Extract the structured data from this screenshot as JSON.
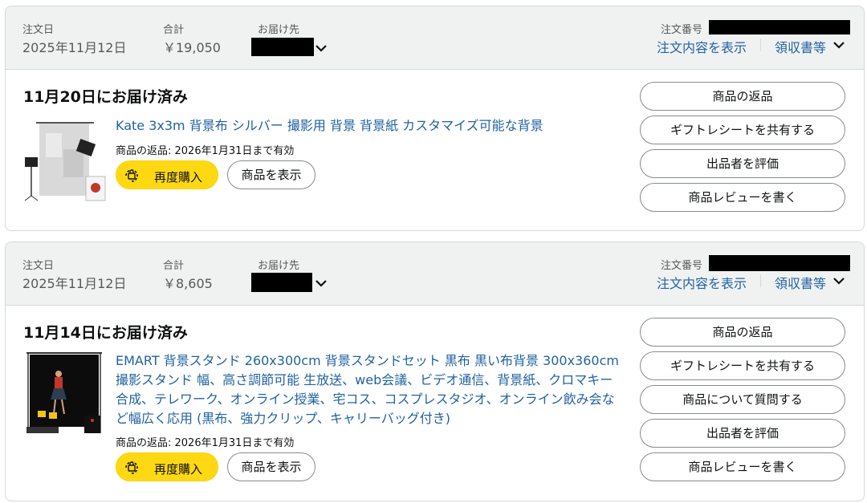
{
  "orders": [
    {
      "header": {
        "date_label": "注文日",
        "date": "2025年11月12日",
        "total_label": "合計",
        "total": "￥19,050",
        "ship_label": "お届け先",
        "order_no_label": "注文番号",
        "view_details": "注文内容を表示",
        "invoice": "領収書等"
      },
      "delivery_status": "11月20日にお届け済み",
      "item": {
        "title": "Kate 3x3m 背景布 シルバー 撮影用 背景 背景紙 カスタマイズ可能な背景",
        "return_note": "商品の返品: 2026年1月31日まで有効",
        "buy_again": "再度購入",
        "view_item": "商品を表示"
      },
      "actions": [
        "商品の返品",
        "ギフトレシートを共有する",
        "出品者を評価",
        "商品レビューを書く"
      ]
    },
    {
      "header": {
        "date_label": "注文日",
        "date": "2025年11月12日",
        "total_label": "合計",
        "total": "￥8,605",
        "ship_label": "お届け先",
        "order_no_label": "注文番号",
        "view_details": "注文内容を表示",
        "invoice": "領収書等"
      },
      "delivery_status": "11月14日にお届け済み",
      "item": {
        "title": "EMART 背景スタンド 260x300cm 背景スタンドセット 黒布 黒い布背景 300x360cm 撮影スタンド 幅、高さ調節可能 生放送、web会議、ビデオ通信、背景紙、クロマキー合成、テレワーク、オンライン授業、宅コス、コスプレスタジオ、オンライン飲み会など幅広く応用 (黒布、強力クリップ、キャリーバッグ付き)",
        "return_note": "商品の返品: 2026年1月31日まで有効",
        "buy_again": "再度購入",
        "view_item": "商品を表示"
      },
      "actions": [
        "商品の返品",
        "ギフトレシートを共有する",
        "商品について質問する",
        "出品者を評価",
        "商品レビューを書く"
      ]
    }
  ]
}
